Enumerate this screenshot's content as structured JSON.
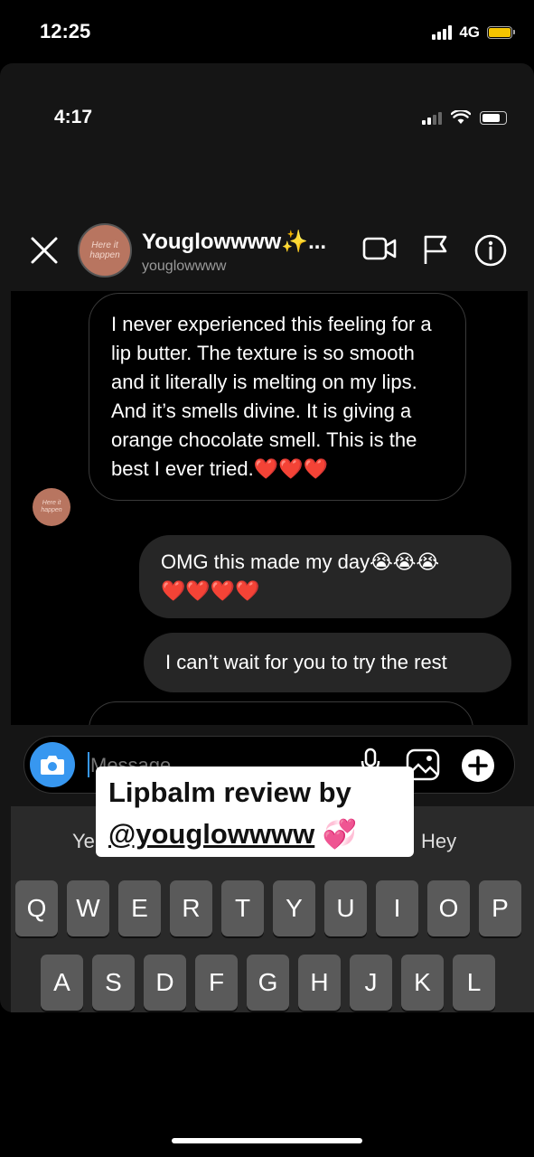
{
  "outer_status": {
    "time": "12:25",
    "network": "4G"
  },
  "inner_status": {
    "time": "4:17"
  },
  "chat_header": {
    "name": "Youglowwww✨...",
    "handle": "youglowwww",
    "avatar_text": "Here it happen",
    "icons": [
      "close-icon",
      "video-call-icon",
      "flag-icon",
      "info-icon"
    ]
  },
  "messages": {
    "received_1": "I never experienced this feeling for a lip butter. The texture is so smooth and it literally is melting on my lips. And it’s smells divine. It is giving a orange chocolate smell. This is the best I ever tried.",
    "received_1_emoji": "❤️❤️❤️",
    "sent_1": "OMG this made my day",
    "sent_1_emoji_1": "😭😭😭",
    "sent_1_emoji_2": "❤️❤️❤️❤️",
    "sent_2": "I can’t wait for you to try the rest"
  },
  "composer": {
    "placeholder": "Message..."
  },
  "keyboard": {
    "suggestion_left": "Ye",
    "suggestion_right": "Hey",
    "row1": [
      "Q",
      "W",
      "E",
      "R",
      "T",
      "Y",
      "U",
      "I",
      "O",
      "P"
    ],
    "row2": [
      "A",
      "S",
      "D",
      "F",
      "G",
      "H",
      "J",
      "K",
      "L"
    ]
  },
  "sticker": {
    "line1": "Lipbalm review by",
    "mention": "@youglowwww",
    "emoji": "💞"
  },
  "colors": {
    "accent": "#3797f0",
    "heart": "#e0142a",
    "battery": "#f5c400"
  }
}
